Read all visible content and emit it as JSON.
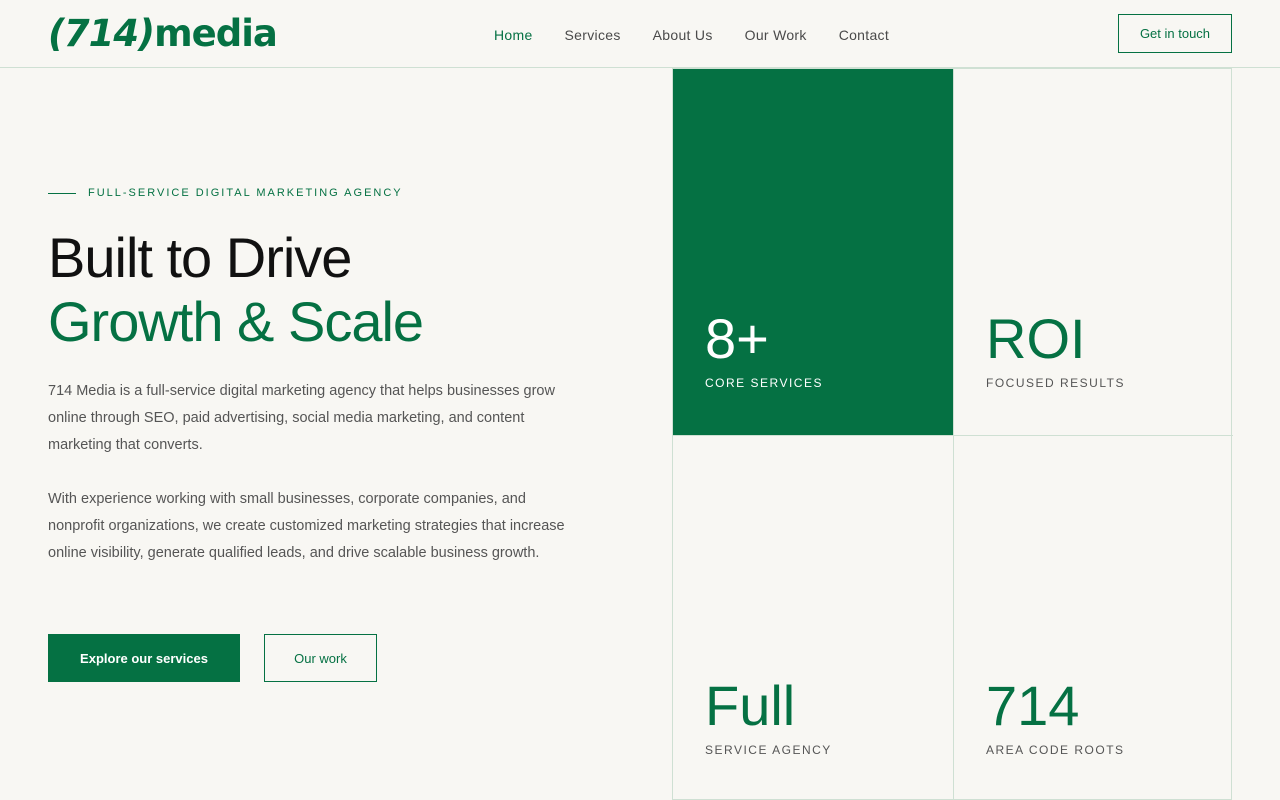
{
  "header": {
    "logo": {
      "paren_text": "(714)",
      "word": "media"
    },
    "nav": [
      {
        "label": "Home",
        "active": true
      },
      {
        "label": "Services",
        "active": false
      },
      {
        "label": "About Us",
        "active": false
      },
      {
        "label": "Our Work",
        "active": false
      },
      {
        "label": "Contact",
        "active": false
      }
    ],
    "cta_label": "Get in touch"
  },
  "hero": {
    "eyebrow": "FULL-SERVICE DIGITAL MARKETING AGENCY",
    "title_line1": "Built to Drive",
    "title_line2": "Growth & Scale",
    "paragraph1": "714 Media is a full-service digital marketing agency that helps businesses grow online through SEO, paid advertising, social media marketing, and content marketing that converts.",
    "paragraph2": "With experience working with small businesses, corporate companies, and nonprofit organizations, we create customized marketing strategies that increase online visibility, generate qualified leads, and drive scalable business growth.",
    "primary_button": "Explore our services",
    "secondary_button": "Our work"
  },
  "stats": [
    {
      "value": "8+",
      "label": "CORE SERVICES"
    },
    {
      "value": "ROI",
      "label": "FOCUSED RESULTS"
    },
    {
      "value": "Full",
      "label": "SERVICE AGENCY"
    },
    {
      "value": "714",
      "label": "AREA CODE ROOTS"
    }
  ],
  "colors": {
    "brand_green": "#057143",
    "background": "#f8f7f3",
    "border": "#cfe0d3"
  }
}
